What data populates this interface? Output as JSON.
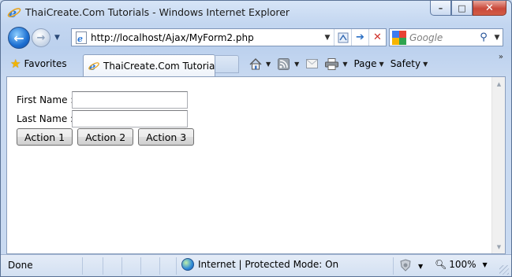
{
  "window": {
    "title": "ThaiCreate.Com Tutorials - Windows Internet Explorer",
    "controls": {
      "minimize": "–",
      "maximize": "□",
      "close": "✕"
    }
  },
  "nav": {
    "back_icon": "back-arrow-icon",
    "forward_icon": "forward-arrow-icon",
    "address": "http://localhost/Ajax/MyForm2.php",
    "search_placeholder": "Google"
  },
  "command_bar": {
    "favorites_label": "Favorites",
    "tab_label": "ThaiCreate.Com Tutorials",
    "page_label": "Page",
    "safety_label": "Safety"
  },
  "form": {
    "first_name_label": "First Name :",
    "first_name_value": "",
    "last_name_label": "Last Name :",
    "last_name_value": "",
    "buttons": [
      "Action 1",
      "Action 2",
      "Action 3"
    ]
  },
  "status": {
    "left": "Done",
    "zone": "Internet | Protected Mode: On",
    "zoom": "100%"
  },
  "colors": {
    "frame": "#c9d9ef",
    "close_button": "#c9493a",
    "content_bg": "#ffffff"
  }
}
